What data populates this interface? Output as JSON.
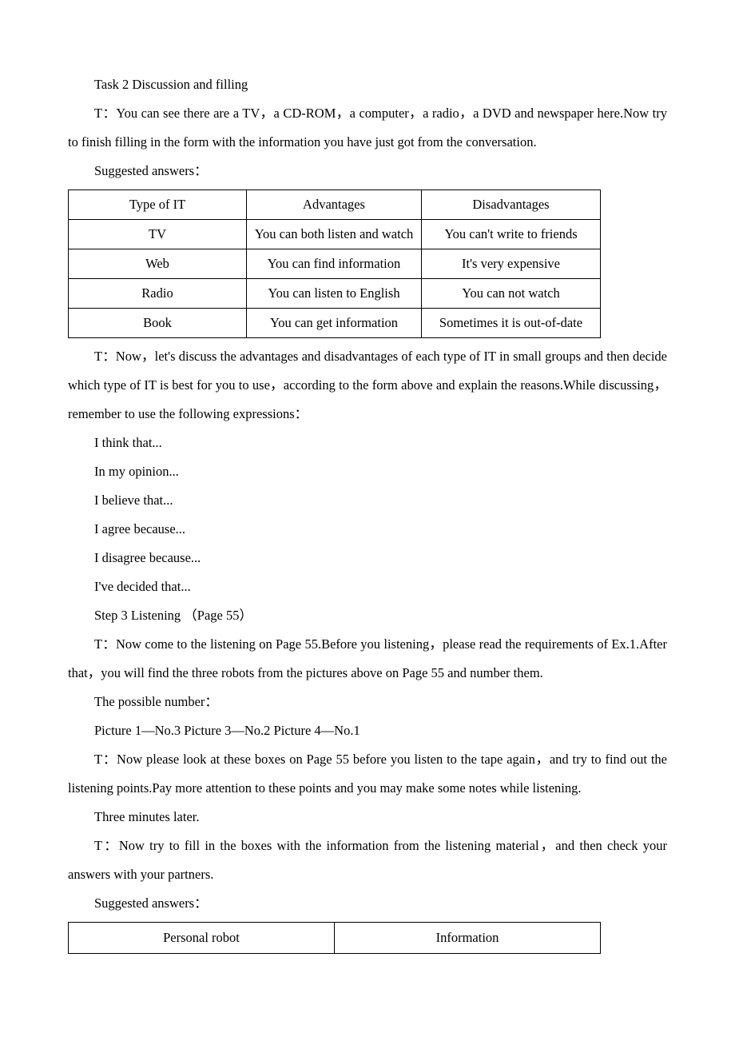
{
  "document": {
    "task_heading": "Task 2 Discussion and filling",
    "paragraphs": {
      "intro": "T：You can see there are a TV，a CD-ROM，a computer，a radio，a DVD and newspaper here.Now try to finish filling in the form with the information you have just got from the conversation.",
      "suggested_answers_1": "Suggested answers：",
      "discuss": "T：Now，let's discuss the advantages and disadvantages of each type of IT in small groups and then decide which type of IT is best for you to use，according to the form above and explain the reasons.While discussing，remember to use the following expressions：",
      "step3_heading": "Step 3 Listening （Page 55）",
      "listening_intro": "T：Now come to the listening on Page 55.Before you listening，please read the requirements of Ex.1.After that，you will find the three robots from the pictures above on Page 55 and number them.",
      "possible_number_label": "The possible number：",
      "possible_number_values": "Picture 1—No.3  Picture 3—No.2  Picture 4—No.1",
      "boxes_instruction": "T：Now please look at these boxes on Page 55 before you listen to the tape again，and try to find out the listening points.Pay more attention to these points and you may make some notes while listening.",
      "three_minutes": "Three minutes later.",
      "fill_boxes": "T：Now try to fill in the boxes with the information from the listening material，and then check your answers with your partners.",
      "suggested_answers_2": "Suggested answers："
    },
    "expressions": [
      "I think that...",
      "In my opinion...",
      "I believe that...",
      "I agree because...",
      "I disagree because...",
      "I've decided that..."
    ],
    "it_table": {
      "headers": [
        "Type of IT",
        "Advantages",
        "Disadvantages"
      ],
      "rows": [
        [
          "TV",
          "You can both listen and watch",
          "You can't write to friends"
        ],
        [
          "Web",
          "You can find information",
          "It's very expensive"
        ],
        [
          "Radio",
          "You can listen to English",
          "You can not watch"
        ],
        [
          "Book",
          "You can get information",
          "Sometimes it is out-of-date"
        ]
      ]
    },
    "robot_table": {
      "headers": [
        "Personal robot",
        "Information"
      ]
    }
  }
}
